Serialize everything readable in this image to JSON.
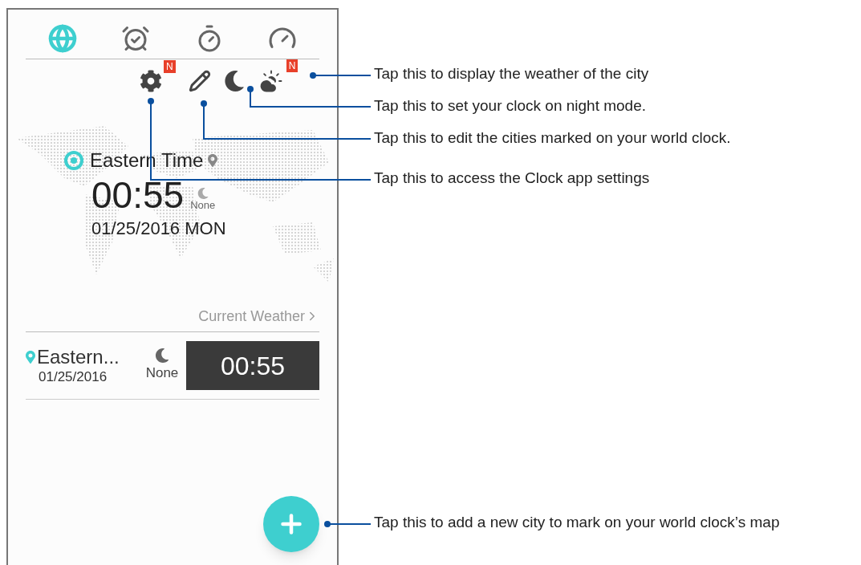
{
  "tabs": [
    {
      "kind": "world",
      "selected": true
    },
    {
      "kind": "alarm",
      "selected": false
    },
    {
      "kind": "stopwatch",
      "selected": false
    },
    {
      "kind": "timer",
      "selected": false
    }
  ],
  "actions": [
    {
      "kind": "settings",
      "badge": "N"
    },
    {
      "kind": "edit"
    },
    {
      "kind": "night"
    },
    {
      "kind": "weather",
      "badge": "N"
    }
  ],
  "main_clock": {
    "city": "Eastern Time",
    "time": "00:55",
    "weather": "None",
    "date": "01/25/2016 MON"
  },
  "current_weather_link": "Current Weather",
  "cities": [
    {
      "name": "Eastern...",
      "date": "01/25/2016",
      "weather": "None",
      "time": "00:55"
    }
  ],
  "callouts": [
    "Tap this to display the weather of the city",
    "Tap this to set your clock on night mode.",
    "Tap this to edit the cities marked on your world clock.",
    "Tap this to access the Clock app settings",
    "Tap this to add a new city to mark on your world clock’s map"
  ]
}
